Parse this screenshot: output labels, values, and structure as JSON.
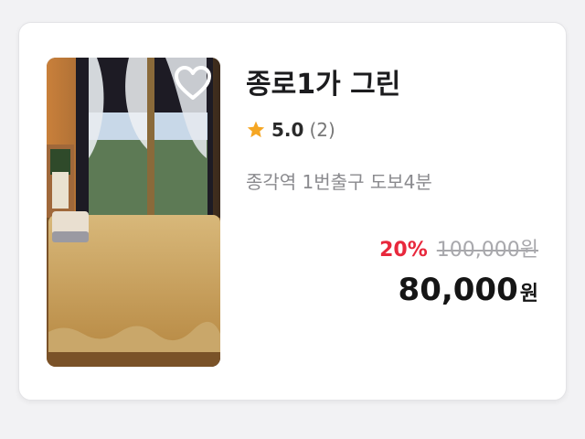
{
  "listing": {
    "title": "종로1가 그린",
    "rating": "5.0",
    "review_count": "(2)",
    "location": "종각역 1번출구 도보4분",
    "discount": "20%",
    "original_price": "100,000원",
    "final_price": "80,000",
    "currency": "원",
    "favorited": false
  },
  "colors": {
    "discount": "#e8283c",
    "star": "#f5a623",
    "title": "#1c1c1e",
    "muted": "#8a8a8e"
  },
  "icons": {
    "favorite": "heart-outline-icon",
    "rating": "star-icon"
  }
}
